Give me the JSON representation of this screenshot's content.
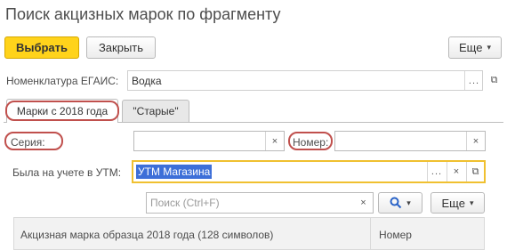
{
  "window": {
    "title": "Поиск акцизных марок по фрагменту"
  },
  "toolbar": {
    "select_label": "Выбрать",
    "close_label": "Закрыть",
    "more_label": "Еще",
    "more_caret": "▾"
  },
  "nomenclature": {
    "label": "Номенклатура ЕГАИС:",
    "value": "Водка",
    "open_icon": "⧉",
    "select_icon": "..."
  },
  "tabs": [
    {
      "label": "Марки с 2018 года",
      "active": true
    },
    {
      "label": "\"Старые\"",
      "active": false
    }
  ],
  "series": {
    "label": "Серия:",
    "value": "",
    "clear_icon": "×"
  },
  "number": {
    "label": "Номер:",
    "value": "",
    "clear_icon": "×"
  },
  "utm": {
    "label": "Была на учете в УТМ:",
    "value": "УТМ Магазина",
    "select_icon": "...",
    "clear_icon": "×",
    "open_icon": "⧉"
  },
  "search": {
    "placeholder": "Поиск (Ctrl+F)",
    "clear_icon": "×",
    "search_icon": "🔍",
    "caret": "▾",
    "more_label": "Еще",
    "more_caret": "▾"
  },
  "table": {
    "columns": [
      "Акцизная марка образца 2018 года (128 символов)",
      "Номер"
    ]
  },
  "colors": {
    "primary_button": "#ffd31b",
    "highlight_oval": "#c0504d",
    "focus_border": "#f0c030",
    "selection": "#3d6fd8"
  }
}
